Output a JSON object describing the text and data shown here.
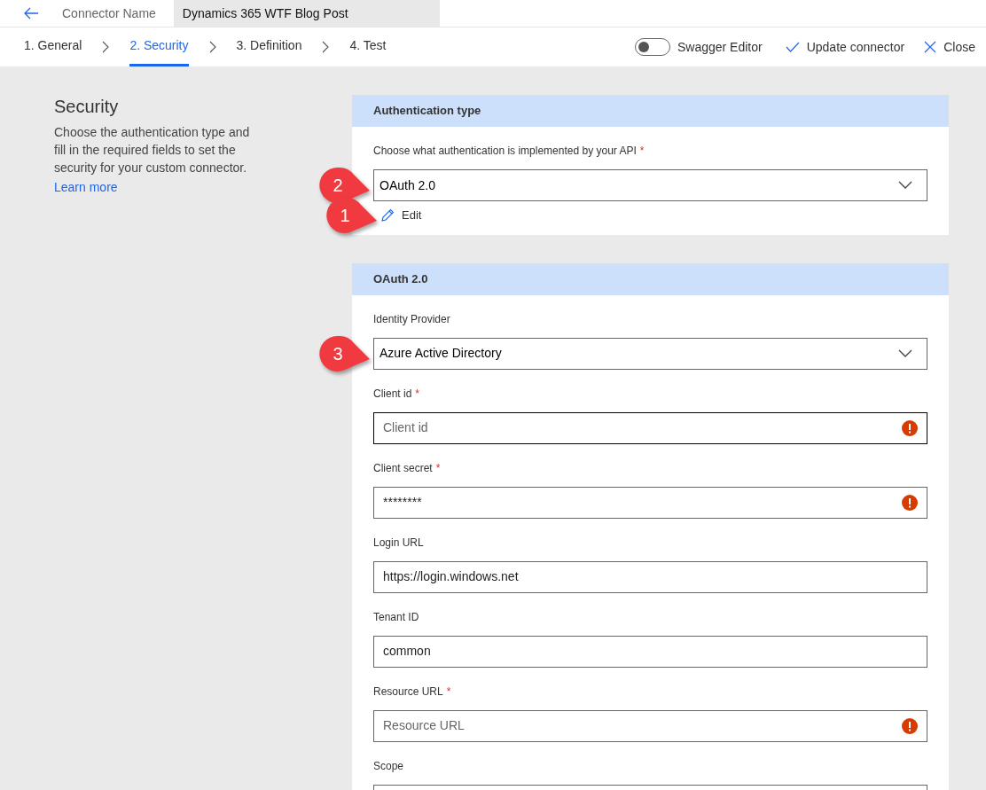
{
  "header": {
    "label": "Connector Name",
    "value": "Dynamics 365 WTF Blog Post"
  },
  "steps": [
    {
      "label": "1. General",
      "selected": false
    },
    {
      "label": "2. Security",
      "selected": true
    },
    {
      "label": "3. Definition",
      "selected": false
    },
    {
      "label": "4. Test",
      "selected": false
    }
  ],
  "toolbar": {
    "swagger_editor": {
      "label": "Swagger Editor",
      "on": false
    },
    "update": "Update connector",
    "close": "Close"
  },
  "intro": {
    "title": "Security",
    "text": "Choose the authentication type and fill in the required fields to set the security for your custom connector.",
    "link": "Learn more"
  },
  "cards": [
    {
      "title": "Authentication type",
      "fields": [
        {
          "kind": "dropdown",
          "label": "Choose what authentication is implemented by your API",
          "required_mark": "*",
          "value": "OAuth 2.0",
          "callout": "2"
        }
      ],
      "edit": {
        "label": "Edit",
        "callout": "1"
      }
    },
    {
      "title": "OAuth 2.0",
      "fields": [
        {
          "kind": "dropdown",
          "label": "Identity Provider",
          "value": "Azure Active Directory",
          "callout": "3"
        },
        {
          "kind": "text",
          "label": "Client id",
          "required_mark": "*",
          "placeholder": "Client id",
          "error": true,
          "focused": true
        },
        {
          "kind": "text",
          "label": "Client secret",
          "required_mark": "*",
          "value": "********",
          "error": true,
          "focused": false
        },
        {
          "kind": "text",
          "label": "Login URL",
          "value": "https://login.windows.net",
          "error": false,
          "focused": false
        },
        {
          "kind": "text",
          "label": "Tenant ID",
          "value": "common",
          "error": false,
          "focused": false
        },
        {
          "kind": "text",
          "label": "Resource URL",
          "required_mark": "*",
          "placeholder": "Resource URL",
          "error": true,
          "focused": false
        },
        {
          "kind": "text",
          "label": "Scope"
        }
      ]
    }
  ]
}
